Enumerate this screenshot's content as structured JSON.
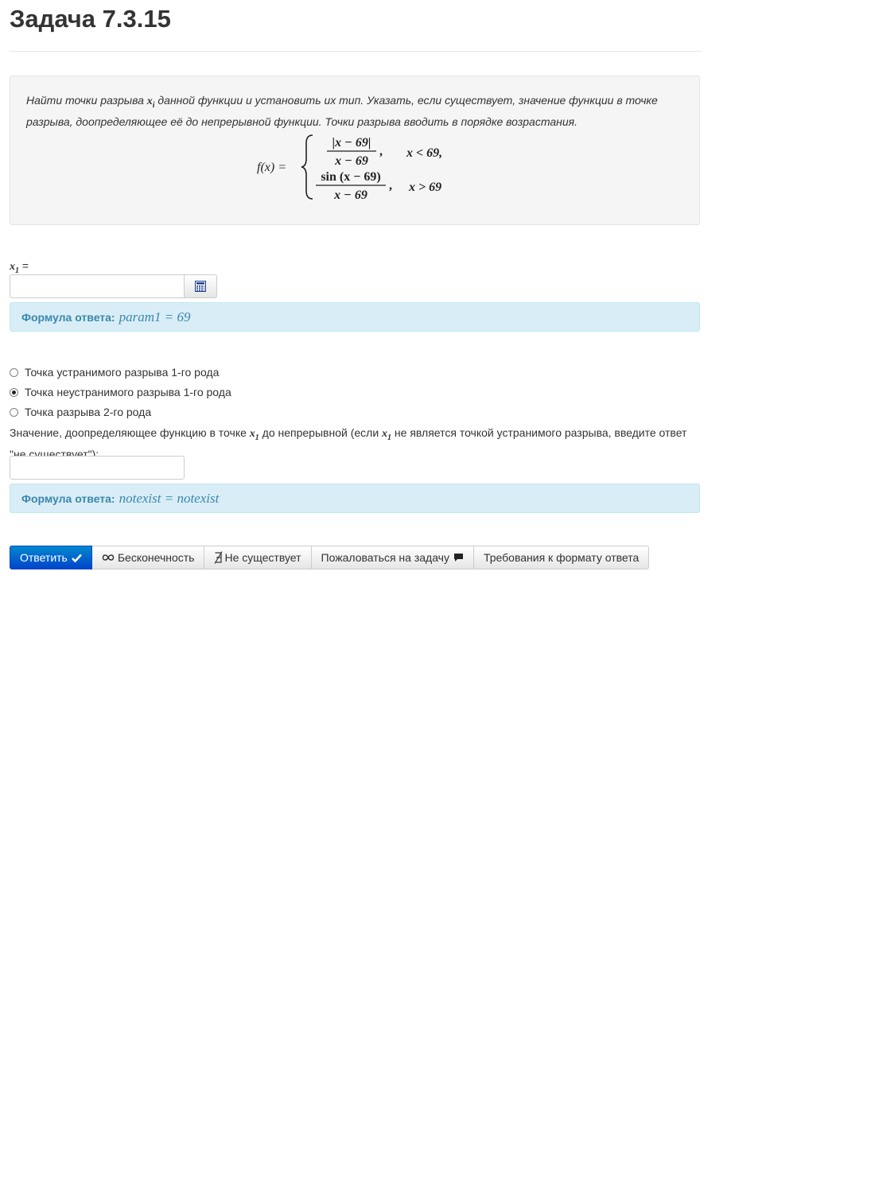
{
  "page": {
    "title": "Задача 7.3.15"
  },
  "task": {
    "text_1": "Найти точки разрыва ",
    "var_xi": "x",
    "var_xi_sub": "i",
    "text_2": " данной функции и установить их тип. Указать, если существует, значение функции в точке разрыва, доопределяющее её до непрерывной функции. Точки разрыва вводить в порядке возрастания.",
    "formula": {
      "lhs": "f(x) =",
      "case1_num": "|x − 69|",
      "case1_den": "x − 69",
      "case1_cond": "x < 69,",
      "case2_num": "sin (x − 69)",
      "case2_den": "x − 69",
      "case2_cond": "x > 69"
    }
  },
  "answer1": {
    "label_var": "x",
    "label_sub": "1",
    "label_eq": " =",
    "value": "",
    "calculator_icon": "calculator-icon",
    "hint_label": "Формула ответа:",
    "hint_formula": "param1 = 69"
  },
  "discontinuity_type": {
    "options": [
      {
        "label": "Точка устранимого разрыва 1-го рода",
        "checked": false
      },
      {
        "label": "Точка неустранимого разрыва 1-го рода",
        "checked": true
      },
      {
        "label": "Точка разрыва 2-го рода",
        "checked": false
      }
    ]
  },
  "answer2": {
    "label_1": "Значение, доопределяющее функцию в точке ",
    "label_var": "x",
    "label_sub": "1",
    "label_2": " до непрерывной (если ",
    "label_3": " не является точкой устранимого разрыва, введите ответ \"не существует\"):",
    "value": "",
    "hint_label": "Формула ответа:",
    "hint_formula": "notexist = notexist"
  },
  "toolbar": {
    "submit_label": "Ответить",
    "submit_icon": "checkmark-icon",
    "infinity_label": "Бесконечность",
    "infinity_icon": "infinity-icon",
    "notexist_label": "Не существует",
    "notexist_icon": "not-exists-icon",
    "report_label": "Пожаловаться на задачу",
    "report_icon": "comment-icon",
    "format_label": "Требования к формату ответа"
  },
  "colors": {
    "primary": "#0055cc",
    "info_bg": "#d9edf7",
    "info_text": "#3a87ad",
    "well_bg": "#f5f5f5"
  }
}
